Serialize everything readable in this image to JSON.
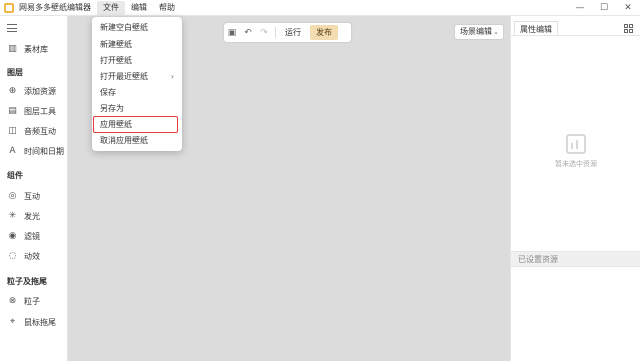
{
  "app": {
    "title": "网易多多壁纸编辑器"
  },
  "menubar": [
    {
      "label": "文件",
      "active": true
    },
    {
      "label": "编辑",
      "active": false
    },
    {
      "label": "帮助",
      "active": false
    }
  ],
  "window_controls": {
    "minimize": "—",
    "maximize": "☐",
    "close": "✕"
  },
  "sidebar": {
    "library_label": "素材库",
    "sections": [
      {
        "title": "图层",
        "items": [
          {
            "icon": "plus-circle-icon",
            "label": "添加资源"
          },
          {
            "icon": "chart-icon",
            "label": "图层工具"
          },
          {
            "icon": "audio-icon",
            "label": "音频互动"
          },
          {
            "icon": "text-icon",
            "label": "时间和日期"
          }
        ]
      },
      {
        "title": "组件",
        "items": [
          {
            "icon": "interaction-icon",
            "label": "互动"
          },
          {
            "icon": "glow-icon",
            "label": "发光"
          },
          {
            "icon": "filter-icon",
            "label": "滤镜"
          },
          {
            "icon": "effect-icon",
            "label": "动效"
          }
        ]
      },
      {
        "title": "粒子及拖尾",
        "items": [
          {
            "icon": "particle-icon",
            "label": "粒子"
          },
          {
            "icon": "trail-icon",
            "label": "鼠标拖尾"
          }
        ]
      }
    ]
  },
  "toolbar": {
    "run_label": "运行",
    "publish_label": "发布"
  },
  "scene_select": {
    "value": "场景编辑"
  },
  "right_panel": {
    "tab_label": "属性编辑",
    "empty_text": "暂未选中资源",
    "resource_section_label": "已设置资源"
  },
  "file_menu": {
    "items": [
      {
        "label": "新建空白壁纸",
        "submenu": false
      },
      {
        "label": "新建壁纸",
        "submenu": false
      },
      {
        "label": "打开壁纸",
        "submenu": false
      },
      {
        "label": "打开最近壁纸",
        "submenu": true
      },
      {
        "label": "保存",
        "submenu": false
      },
      {
        "label": "另存为",
        "submenu": false
      },
      {
        "label": "应用壁纸",
        "submenu": false
      },
      {
        "label": "取消应用壁纸",
        "submenu": false
      }
    ],
    "highlighted_item": "应用壁纸"
  },
  "colors": {
    "accent": "#f3dcb0",
    "canvas_bg": "#dcdcdc",
    "highlight_border": "#e23c3c"
  }
}
